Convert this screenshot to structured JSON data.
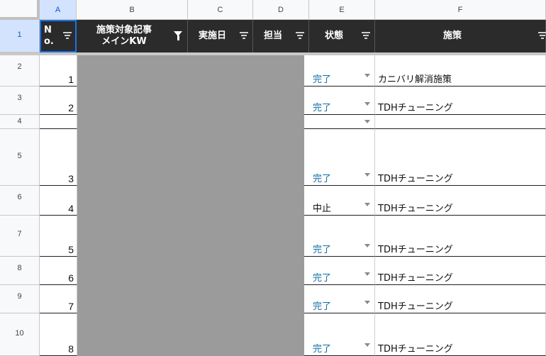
{
  "columns": [
    "A",
    "B",
    "C",
    "D",
    "E",
    "F"
  ],
  "headers": {
    "a": "N\no.",
    "b": "施策対象記事\nメインKW",
    "c": "実施日",
    "d": "担当",
    "e": "状態",
    "f": "施策"
  },
  "row_numbers": [
    "1",
    "2",
    "3",
    "4",
    "5",
    "6",
    "7",
    "8",
    "9",
    "10"
  ],
  "rows": [
    {
      "row": "2",
      "no": "1",
      "status": "完了",
      "measure": "カニバリ解消施策"
    },
    {
      "row": "3",
      "no": "2",
      "status": "完了",
      "measure": "TDHチューニング"
    },
    {
      "row": "4",
      "no": "",
      "status": "",
      "measure": ""
    },
    {
      "row": "5",
      "no": "3",
      "status": "完了",
      "measure": "TDHチューニング"
    },
    {
      "row": "6",
      "no": "4",
      "status": "中止",
      "measure": "TDHチューニング"
    },
    {
      "row": "7",
      "no": "5",
      "status": "完了",
      "measure": "TDHチューニング"
    },
    {
      "row": "8",
      "no": "6",
      "status": "完了",
      "measure": "TDHチューニング"
    },
    {
      "row": "9",
      "no": "7",
      "status": "完了",
      "measure": "TDHチューニング"
    },
    {
      "row": "10",
      "no": "8",
      "status": "完了",
      "measure": "TDHチューニング"
    }
  ],
  "colors": {
    "header_bg": "#2b2b2b",
    "status_done": "#0f6fa3",
    "redacted": "#9b9b9b",
    "selection": "#1a73e8"
  }
}
